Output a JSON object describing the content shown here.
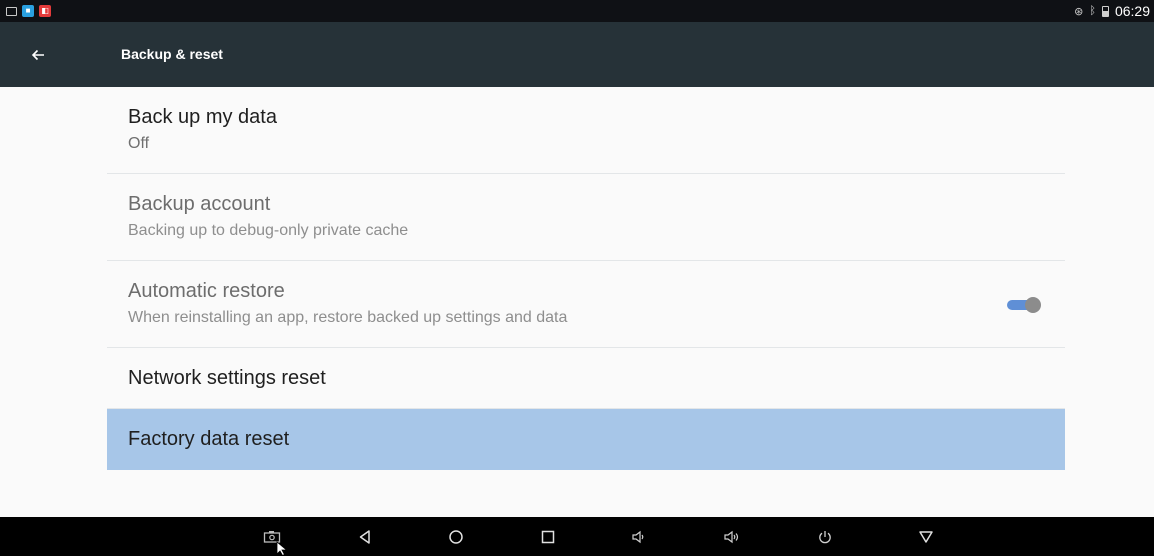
{
  "status_bar": {
    "notification_icons": [
      "screen-icon",
      "app-icon-blue",
      "app-icon-red"
    ],
    "status_icons": [
      "location-icon",
      "bluetooth-icon",
      "battery-icon"
    ],
    "time": "06:29"
  },
  "app_bar": {
    "title": "Backup & reset"
  },
  "items": [
    {
      "title": "Back up my data",
      "summary": "Off"
    },
    {
      "title": "Backup account",
      "summary": "Backing up to debug-only private cache"
    },
    {
      "title": "Automatic restore",
      "summary": "When reinstalling an app, restore backed up settings and data",
      "toggle": "on"
    },
    {
      "title": "Network settings reset"
    },
    {
      "title": "Factory data reset"
    }
  ],
  "nav_bar": {
    "buttons": [
      "screenshot-icon",
      "back-icon",
      "home-icon",
      "recents-icon",
      "volume-down-icon",
      "volume-up-icon",
      "power-icon",
      "hide-navbar-icon"
    ]
  },
  "colors": {
    "status_bar": "#0f1115",
    "app_bar": "#263238",
    "selected_row": "#a7c6e8",
    "toggle_track": "#5f8fd6",
    "nav_bar": "#000000"
  }
}
